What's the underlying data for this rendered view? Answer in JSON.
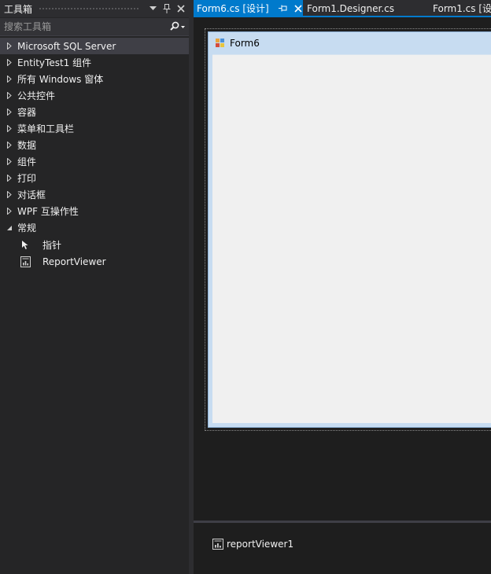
{
  "toolbox": {
    "title": "工具箱",
    "search_placeholder": "搜索工具箱",
    "groups": [
      {
        "label": "Microsoft SQL Server",
        "expanded": false,
        "selected": true
      },
      {
        "label": "EntityTest1 组件",
        "expanded": false
      },
      {
        "label": "所有 Windows 窗体",
        "expanded": false
      },
      {
        "label": "公共控件",
        "expanded": false
      },
      {
        "label": "容器",
        "expanded": false
      },
      {
        "label": "菜单和工具栏",
        "expanded": false
      },
      {
        "label": "数据",
        "expanded": false
      },
      {
        "label": "组件",
        "expanded": false
      },
      {
        "label": "打印",
        "expanded": false
      },
      {
        "label": "对话框",
        "expanded": false
      },
      {
        "label": "WPF 互操作性",
        "expanded": false
      },
      {
        "label": "常规",
        "expanded": true
      }
    ],
    "general_items": [
      {
        "label": "指针",
        "icon": "pointer-icon"
      },
      {
        "label": "ReportViewer",
        "icon": "report-viewer-icon"
      }
    ]
  },
  "tabs": [
    {
      "label": "Form6.cs [设计]",
      "active": true
    },
    {
      "label": "Form1.Designer.cs",
      "active": false
    },
    {
      "label": "Form1.cs [设",
      "active": false
    }
  ],
  "designer": {
    "form_title": "Form6",
    "tray_component": "reportViewer1"
  },
  "colors": {
    "accent": "#007acc",
    "panel_bg": "#252526",
    "editor_bg": "#1e1e1e",
    "form_frame": "#c7dcf1",
    "form_client": "#f0f0f0"
  }
}
